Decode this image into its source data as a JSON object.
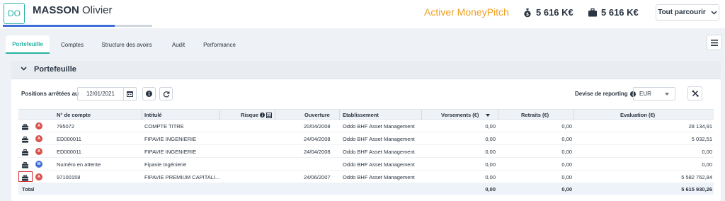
{
  "header": {
    "avatar_initials": "DO",
    "client_last_name": "MASSON",
    "client_first_name": "Olivier",
    "progress_fraction": 0.75,
    "moneypitch_link": "Activer MoneyPitch",
    "amount_1": "5 616 K€",
    "amount_2": "5 616 K€",
    "browse_button": "Tout parcourir"
  },
  "tabs": [
    "Portefeuille",
    "Comptes",
    "Structure des avoirs",
    "Audit",
    "Performance"
  ],
  "active_tab": "Portefeuille",
  "panel": {
    "title": "Portefeuille",
    "positions_label": "Positions arrêtées au",
    "positions_date": "12/01/2021",
    "devise_label": "Devise de reporting",
    "devise_value": "EUR"
  },
  "table": {
    "headers": {
      "account": "N° de compte",
      "title": "Intitulé",
      "risk": "Risque",
      "opening": "Ouverture",
      "institution": "Etablissement",
      "deposits": "Versements (€)",
      "withdrawals": "Retraits (€)",
      "valuation": "Evaluation (€)"
    },
    "rows": [
      {
        "badge": "A",
        "account": "795072",
        "title": "COMPTE TITRE",
        "opening": "20/04/2008",
        "institution": "Oddo BHF Asset Management",
        "deposits": "0,00",
        "withdrawals": "0,00",
        "valuation": "28 134,91"
      },
      {
        "badge": "A",
        "account": "ED000011",
        "title": "FIPAVIE INGENIERIE",
        "opening": "24/04/2008",
        "institution": "Oddo BHF Asset Management",
        "deposits": "0,00",
        "withdrawals": "0,00",
        "valuation": "5 032,51"
      },
      {
        "badge": "A",
        "account": "ED000011",
        "title": "FIPAVIE INGENIERIE",
        "opening": "24/04/2008",
        "institution": "Oddo BHF Asset Management",
        "deposits": "0,00",
        "withdrawals": "0,00",
        "valuation": "0,00"
      },
      {
        "badge": "M",
        "account": "Numéro en attente",
        "title": "Fipavie Ingénierie",
        "opening": "",
        "institution": "Oddo BHF Asset Management",
        "deposits": "0,00",
        "withdrawals": "0,00",
        "valuation": "0,00"
      },
      {
        "badge": "A",
        "account": "97100158",
        "title": "FIPAVIE PREMIUM CAPITALI...",
        "opening": "24/06/2007",
        "institution": "Oddo BHF Asset Management",
        "deposits": "0,00",
        "withdrawals": "0,00",
        "valuation": "5 582 762,84"
      }
    ],
    "total": {
      "label": "Total",
      "deposits": "0,00",
      "withdrawals": "0,00",
      "valuation": "5 615 930,26"
    }
  },
  "colors": {
    "accent": "#2ab3a4",
    "moneypitch": "#f0a020",
    "progress": "#3f6fd6",
    "badge_a": "#d9534f",
    "badge_m": "#3f6fd6"
  }
}
